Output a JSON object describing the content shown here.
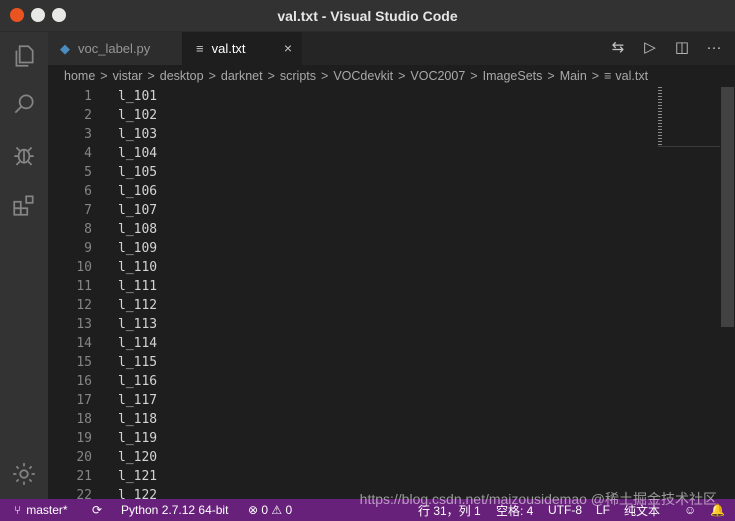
{
  "window": {
    "title": "val.txt - Visual Studio Code"
  },
  "tabs": [
    {
      "label": "voc_label.py"
    },
    {
      "label": "val.txt",
      "close": "×"
    }
  ],
  "tab_actions": [
    "⇆",
    "▷",
    "◫",
    "···"
  ],
  "breadcrumb": [
    "home",
    "vistar",
    "desktop",
    "darknet",
    "scripts",
    "VOCdevkit",
    "VOC2007",
    "ImageSets",
    "Main",
    "val.txt"
  ],
  "breadcrumb_sep": ">",
  "editor": {
    "lines": [
      {
        "n": "1",
        "t": "l_101"
      },
      {
        "n": "2",
        "t": "l_102"
      },
      {
        "n": "3",
        "t": "l_103"
      },
      {
        "n": "4",
        "t": "l_104"
      },
      {
        "n": "5",
        "t": "l_105"
      },
      {
        "n": "6",
        "t": "l_106"
      },
      {
        "n": "7",
        "t": "l_107"
      },
      {
        "n": "8",
        "t": "l_108"
      },
      {
        "n": "9",
        "t": "l_109"
      },
      {
        "n": "10",
        "t": "l_110"
      },
      {
        "n": "11",
        "t": "l_111"
      },
      {
        "n": "12",
        "t": "l_112"
      },
      {
        "n": "13",
        "t": "l_113"
      },
      {
        "n": "14",
        "t": "l_114"
      },
      {
        "n": "15",
        "t": "l_115"
      },
      {
        "n": "16",
        "t": "l_116"
      },
      {
        "n": "17",
        "t": "l_117"
      },
      {
        "n": "18",
        "t": "l_118"
      },
      {
        "n": "19",
        "t": "l_119"
      },
      {
        "n": "20",
        "t": "l_120"
      },
      {
        "n": "21",
        "t": "l_121"
      },
      {
        "n": "22",
        "t": "l_122"
      }
    ]
  },
  "status": {
    "branch": "master*",
    "sync": "⟳",
    "python": "Python 2.7.12 64-bit",
    "problems": "⊗ 0 ⚠ 0",
    "position": "行 31，列 1",
    "indent": "空格: 4",
    "encoding": "UTF-8",
    "eol": "LF",
    "language": "纯文本"
  },
  "watermark": "https://blog.csdn.net/maizousidemao  @稀土掘金技术社区",
  "colors": {
    "statusbar": "#68217a",
    "editor_bg": "#1e1e1e",
    "activity_bg": "#333333"
  }
}
